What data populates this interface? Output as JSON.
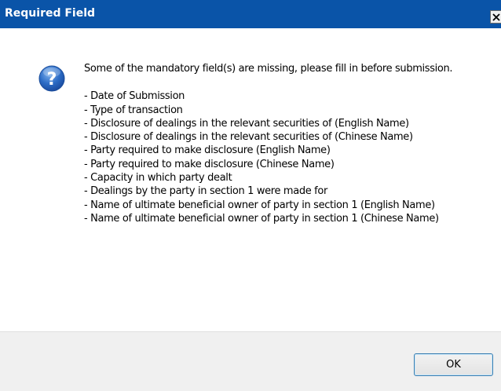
{
  "window": {
    "title": "Required Field",
    "close_icon": "close-icon"
  },
  "message": {
    "icon": "question-icon",
    "intro": "Some of the mandatory field(s) are missing, please fill in before submission.",
    "missing_fields": [
      "- Date of Submission",
      "- Type of transaction",
      "- Disclosure of dealings in the relevant securities of (English Name)",
      "- Disclosure of dealings in the relevant securities of (Chinese Name)",
      "- Party required to make disclosure (English Name)",
      "- Party required to make disclosure (Chinese Name)",
      "- Capacity in which party dealt",
      "- Dealings by the party in section 1 were made for",
      "- Name of ultimate beneficial owner of party in section 1 (English Name)",
      "- Name of ultimate beneficial owner of party in section 1 (Chinese Name)"
    ]
  },
  "footer": {
    "ok_label": "OK"
  },
  "colors": {
    "titlebar": "#0a54a8",
    "footer": "#f0f0f0",
    "icon_blue": "#1d5fb8"
  }
}
